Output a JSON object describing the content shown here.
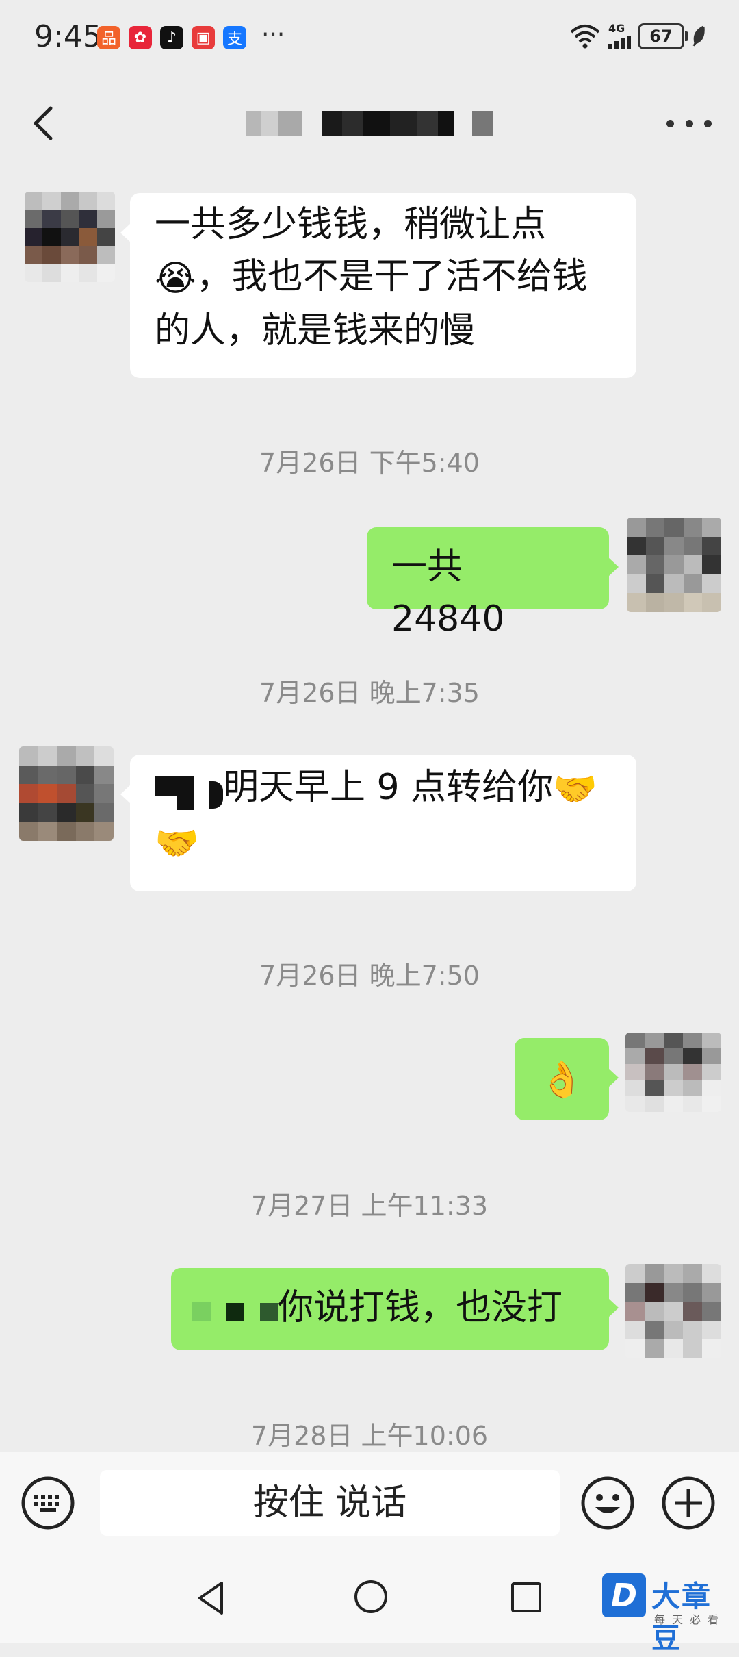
{
  "status_bar": {
    "time": "9:45",
    "apps": [
      {
        "icon": "app-orange-icon",
        "glyph": "品",
        "color": "#f2622a"
      },
      {
        "icon": "app-red-icon",
        "glyph": "✿",
        "color": "#e8263a"
      },
      {
        "icon": "tiktok-icon",
        "glyph": "♪",
        "color": "#111111"
      },
      {
        "icon": "app-red-square-icon",
        "glyph": "▣",
        "color": "#e83b3b"
      },
      {
        "icon": "alipay-icon",
        "glyph": "支",
        "color": "#1677ff"
      }
    ],
    "more": "···",
    "network": "4G",
    "battery": "67"
  },
  "header": {
    "back_icon": "chevron-left-icon",
    "more_icon": "ellipsis-icon"
  },
  "messages": [
    {
      "type": "incoming",
      "text": "一共多少钱钱，稍微让点",
      "text2": "，我也不是干了活不给钱",
      "text3": "的人，就是钱来的慢",
      "emoji": "😭"
    },
    {
      "type": "timestamp",
      "text": "7月26日 下午5:40"
    },
    {
      "type": "outgoing",
      "text": "一共 24840"
    },
    {
      "type": "timestamp",
      "text": "7月26日 晚上7:35"
    },
    {
      "type": "incoming",
      "text": "明天早上 9 点转给你",
      "emoji": "🤝"
    },
    {
      "type": "timestamp",
      "text": "7月26日 晚上7:50"
    },
    {
      "type": "outgoing",
      "text": "",
      "emoji": "👌"
    },
    {
      "type": "timestamp",
      "text": "7月27日 上午11:33"
    },
    {
      "type": "outgoing",
      "text": "你说打钱，也没打"
    },
    {
      "type": "timestamp",
      "text": "7月28日 上午10:06"
    }
  ],
  "input_bar": {
    "keyboard_icon": "keyboard-icon",
    "hold_to_talk": "按住 说话",
    "emoji_icon": "smiley-icon",
    "plus_icon": "plus-circle-icon"
  },
  "watermark": {
    "logo": "D",
    "text": "大章豆",
    "sub": "每天必看"
  }
}
